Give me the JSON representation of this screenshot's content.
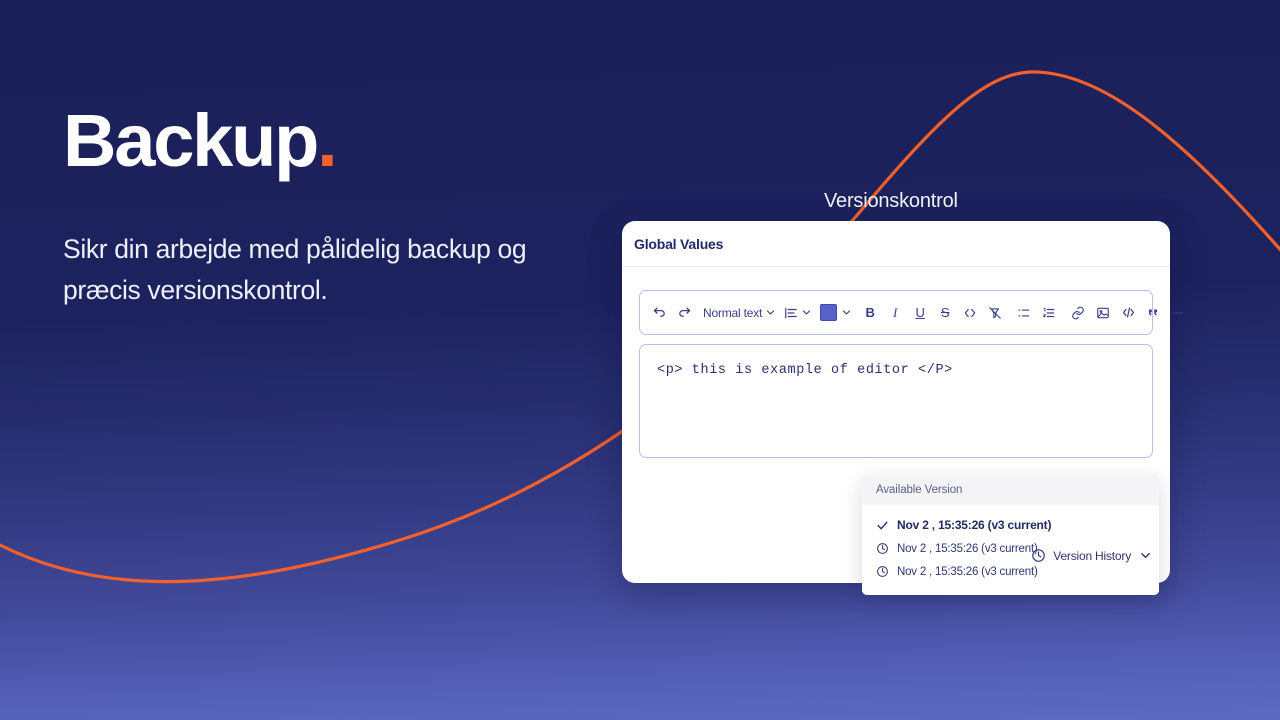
{
  "hero": {
    "title": "Backup",
    "title_dot": ".",
    "subtitle": "Sikr din arbejde med pålidelig backup og præcis versionskontrol."
  },
  "caption": "Versionskontrol",
  "colors": {
    "background_top": "#1C225E",
    "background_bottom": "#5E69C2",
    "accent_orange": "#F2602C",
    "text_on_dark": "#FFFFFF",
    "card_background": "#FFFFFF",
    "editor_border": "#B9BFE8",
    "toolbar_icon": "#3A3F87",
    "color_swatch": "#5A62C8"
  },
  "card": {
    "title": "Global Values",
    "toolbar": {
      "undo": "undo-icon",
      "redo": "redo-icon",
      "style_label": "Normal text",
      "style_chevron": "chevron-down-icon",
      "align": "align-left-icon",
      "align_chevron": "chevron-down-icon",
      "color_swatch": "text-color-swatch",
      "color_chevron": "chevron-down-icon",
      "bold": "B",
      "italic": "I",
      "underline": "U",
      "strikethrough": "S",
      "inline_code": "code-brackets-icon",
      "clear_format": "clear-formatting-icon",
      "bullet_list": "bullet-list-icon",
      "numbered_list": "numbered-list-icon",
      "link": "link-icon",
      "image": "image-icon",
      "code_block": "code-block-icon",
      "quote": "blockquote-icon",
      "divider": "horizontal-rule-icon"
    },
    "content": "<p> this is example of editor </P>",
    "dropdown": {
      "header": "Available Version",
      "items": [
        {
          "label": "Nov 2 , 15:35:26 (v3 current)",
          "icon": "check-icon",
          "current": true
        },
        {
          "label": "Nov 2 , 15:35:26 (v3 current)",
          "icon": "clock-icon",
          "current": false
        },
        {
          "label": "Nov 2 , 15:35:26 (v3 current)",
          "icon": "clock-icon",
          "current": false
        }
      ]
    },
    "footer": {
      "clock_icon": "clock-icon",
      "label": "Version History",
      "chevron": "chevron-down-icon"
    }
  }
}
